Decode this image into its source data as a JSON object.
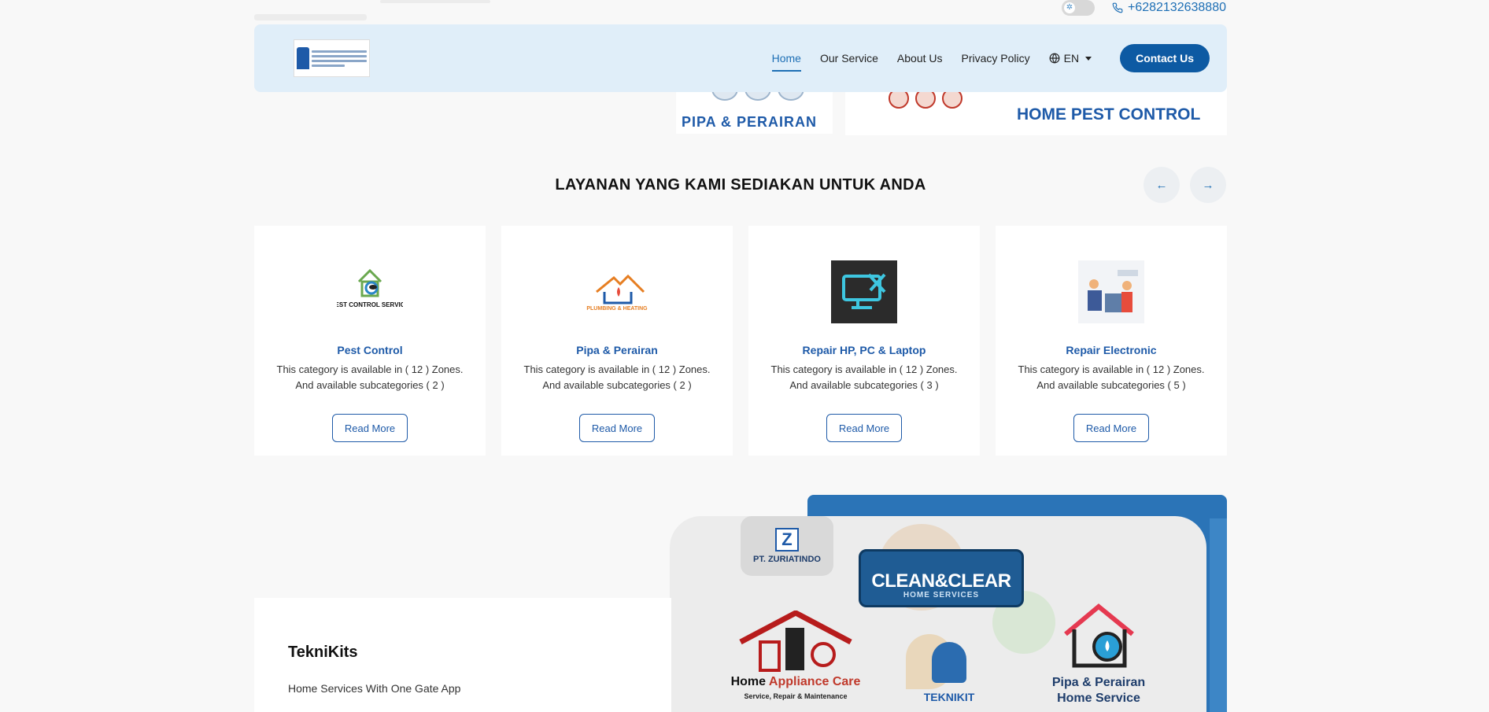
{
  "topbar": {
    "phone": "+6282132638880"
  },
  "nav": {
    "links": [
      "Home",
      "Our Service",
      "About Us",
      "Privacy Policy"
    ],
    "language": "EN",
    "contact_label": "Contact Us"
  },
  "hero": {
    "banner_left_caption": "PIPA & PERAIRAN",
    "banner_right_caption": "HOME PEST CONTROL"
  },
  "services": {
    "title": "LAYANAN YANG KAMI SEDIAKAN UNTUK ANDA",
    "prev_icon": "←",
    "next_icon": "→",
    "cards": [
      {
        "name": "Pest Control",
        "zones_text": "This category is available in ( 12 ) Zones.",
        "sub_text": "And available subcategories ( 2 )",
        "button": "Read More",
        "image_caption": "PEST CONTROL SERVICE"
      },
      {
        "name": "Pipa & Perairan",
        "zones_text": "This category is available in ( 12 ) Zones.",
        "sub_text": "And available subcategories ( 2 )",
        "button": "Read More",
        "image_caption": "PLUMBING & HEATING"
      },
      {
        "name": "Repair HP, PC & Laptop",
        "zones_text": "This category is available in ( 12 ) Zones.",
        "sub_text": "And available subcategories ( 3 )",
        "button": "Read More"
      },
      {
        "name": "Repair Electronic",
        "zones_text": "This category is available in ( 12 ) Zones.",
        "sub_text": "And available subcategories ( 5 )",
        "button": "Read More"
      }
    ]
  },
  "collage": {
    "company": "PT. ZURIATINDO",
    "clean_title": "CLEAN&CLEAR",
    "clean_sub": "HOME SERVICES",
    "appliance_home": "Home ",
    "appliance_care": "Appliance Care",
    "appliance_sub": "Service, Repair & Maintenance",
    "teknikit": "TEKNIKIT",
    "pipa_line1": "Pipa & Perairan",
    "pipa_line2": "Home  Service"
  },
  "about": {
    "brand": "TekniKits",
    "tagline": "Home Services With One Gate App"
  }
}
